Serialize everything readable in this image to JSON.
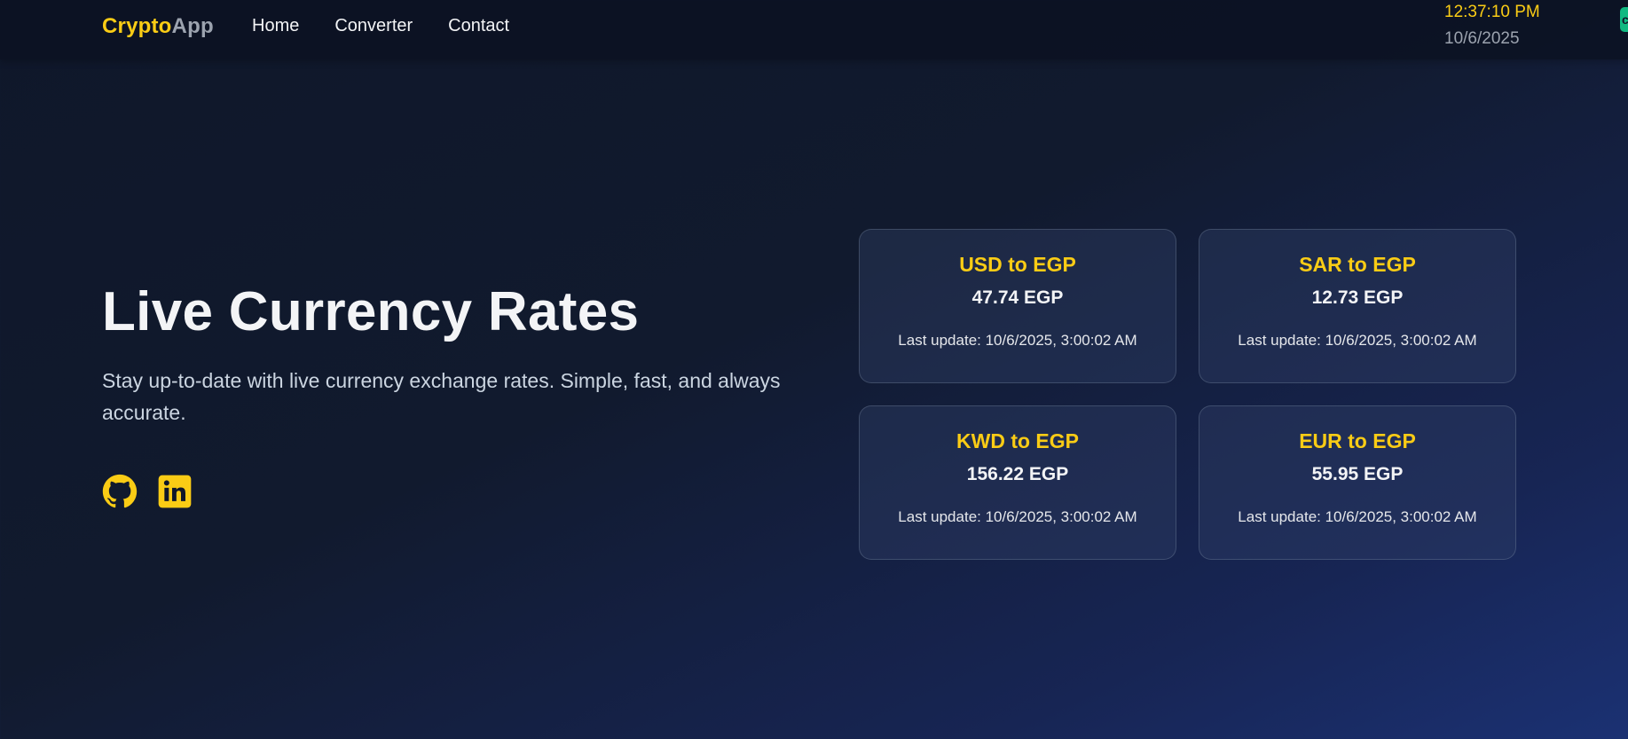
{
  "nav": {
    "brand_part1": "Crypto",
    "brand_part2": "App",
    "links": [
      "Home",
      "Converter",
      "Contact"
    ],
    "clock_time": "12:37:10 PM",
    "clock_date": "10/6/2025"
  },
  "hero": {
    "title": "Live Currency Rates",
    "subtitle": "Stay up-to-date with live currency exchange rates. Simple, fast, and always accurate.",
    "social_icons": [
      "github-icon",
      "linkedin-icon"
    ]
  },
  "rates": [
    {
      "pair": "USD to EGP",
      "value": "47.74 EGP",
      "updated": "Last update: 10/6/2025, 3:00:02 AM"
    },
    {
      "pair": "SAR to EGP",
      "value": "12.73 EGP",
      "updated": "Last update: 10/6/2025, 3:00:02 AM"
    },
    {
      "pair": "KWD to EGP",
      "value": "156.22 EGP",
      "updated": "Last update: 10/6/2025, 3:00:02 AM"
    },
    {
      "pair": "EUR to EGP",
      "value": "55.95 EGP",
      "updated": "Last update: 10/6/2025, 3:00:02 AM"
    }
  ],
  "colors": {
    "accent": "#facc15",
    "background": "#0f172a",
    "background_end": "#1e3a8a"
  }
}
